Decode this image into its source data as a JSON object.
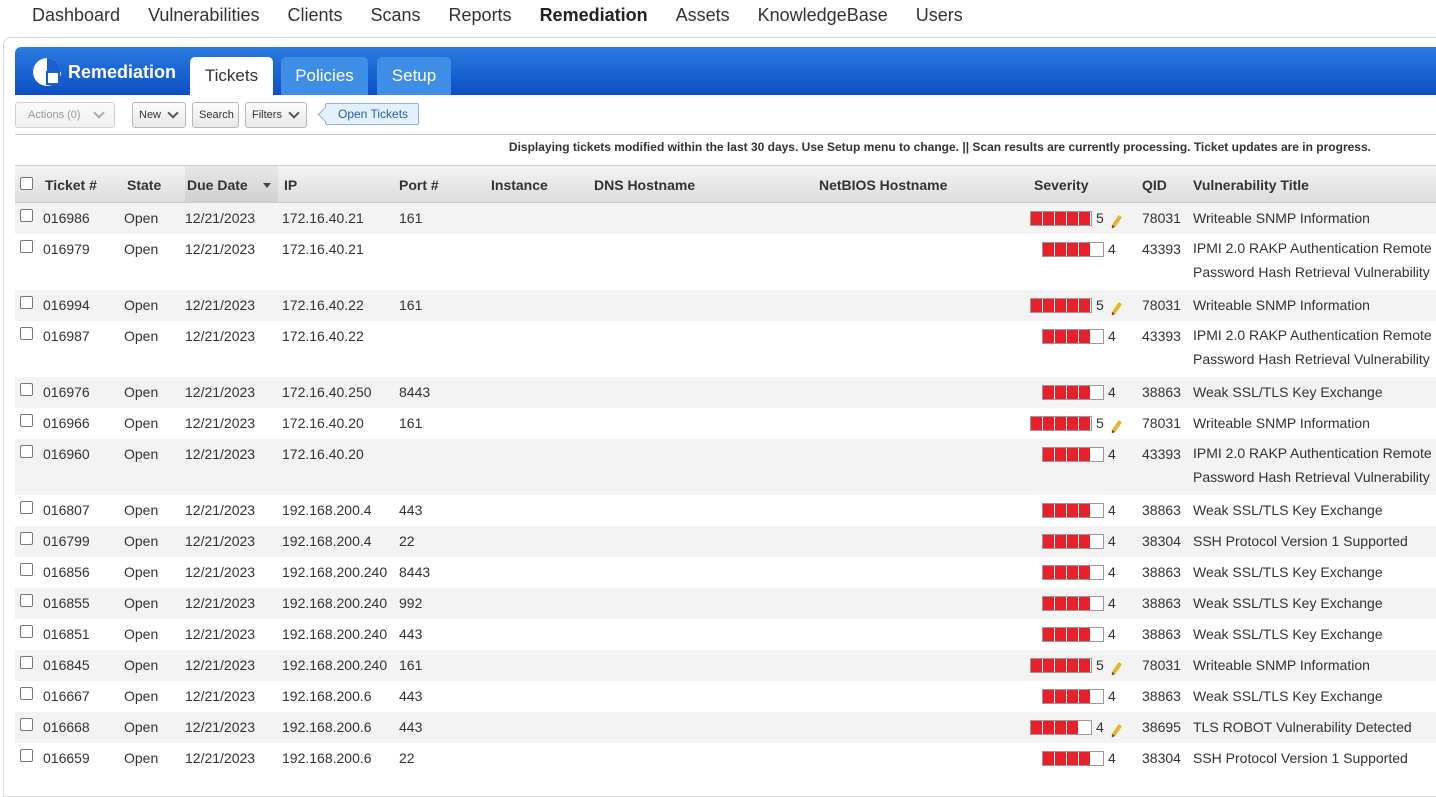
{
  "nav": [
    "Dashboard",
    "Vulnerabilities",
    "Clients",
    "Scans",
    "Reports",
    "Remediation",
    "Assets",
    "KnowledgeBase",
    "Users"
  ],
  "nav_active": "Remediation",
  "module": {
    "title": "Remediation",
    "tabs": [
      "Tickets",
      "Policies",
      "Setup"
    ]
  },
  "toolbar": {
    "actions": "Actions (0)",
    "new": "New",
    "search": "Search",
    "filters": "Filters",
    "open_tickets": "Open Tickets"
  },
  "banner": "Displaying tickets modified within the last 30 days. Use Setup menu to change. || Scan results are currently processing. Ticket updates are in progress.",
  "columns": [
    "Ticket #",
    "State",
    "Due Date",
    "IP",
    "Port #",
    "Instance",
    "DNS Hostname",
    "NetBIOS Hostname",
    "Severity",
    "QID",
    "Vulnerability Title"
  ],
  "colors": {
    "accent": "#1a5fd0",
    "severity": "#e8202a",
    "pencil": "#e8b52a"
  },
  "rows": [
    {
      "ticket": "016986",
      "state": "Open",
      "due": "12/21/2023",
      "ip": "172.16.40.21",
      "port": "161",
      "sev": "5",
      "qid": "78031",
      "title": "Writeable SNMP Information",
      "edit": true
    },
    {
      "ticket": "016979",
      "state": "Open",
      "due": "12/21/2023",
      "ip": "172.16.40.21",
      "port": "",
      "sev": "4",
      "qid": "43393",
      "title": "IPMI 2.0 RAKP Authentication Remote Password Hash Retrieval Vulnerability",
      "edit": false
    },
    {
      "ticket": "016994",
      "state": "Open",
      "due": "12/21/2023",
      "ip": "172.16.40.22",
      "port": "161",
      "sev": "5",
      "qid": "78031",
      "title": "Writeable SNMP Information",
      "edit": true
    },
    {
      "ticket": "016987",
      "state": "Open",
      "due": "12/21/2023",
      "ip": "172.16.40.22",
      "port": "",
      "sev": "4",
      "qid": "43393",
      "title": "IPMI 2.0 RAKP Authentication Remote Password Hash Retrieval Vulnerability",
      "edit": false
    },
    {
      "ticket": "016976",
      "state": "Open",
      "due": "12/21/2023",
      "ip": "172.16.40.250",
      "port": "8443",
      "sev": "4",
      "qid": "38863",
      "title": "Weak SSL/TLS Key Exchange",
      "edit": false
    },
    {
      "ticket": "016966",
      "state": "Open",
      "due": "12/21/2023",
      "ip": "172.16.40.20",
      "port": "161",
      "sev": "5",
      "qid": "78031",
      "title": "Writeable SNMP Information",
      "edit": true
    },
    {
      "ticket": "016960",
      "state": "Open",
      "due": "12/21/2023",
      "ip": "172.16.40.20",
      "port": "",
      "sev": "4",
      "qid": "43393",
      "title": "IPMI 2.0 RAKP Authentication Remote Password Hash Retrieval Vulnerability",
      "edit": false
    },
    {
      "ticket": "016807",
      "state": "Open",
      "due": "12/21/2023",
      "ip": "192.168.200.4",
      "port": "443",
      "sev": "4",
      "qid": "38863",
      "title": "Weak SSL/TLS Key Exchange",
      "edit": false
    },
    {
      "ticket": "016799",
      "state": "Open",
      "due": "12/21/2023",
      "ip": "192.168.200.4",
      "port": "22",
      "sev": "4",
      "qid": "38304",
      "title": "SSH Protocol Version 1 Supported",
      "edit": false
    },
    {
      "ticket": "016856",
      "state": "Open",
      "due": "12/21/2023",
      "ip": "192.168.200.240",
      "port": "8443",
      "sev": "4",
      "qid": "38863",
      "title": "Weak SSL/TLS Key Exchange",
      "edit": false
    },
    {
      "ticket": "016855",
      "state": "Open",
      "due": "12/21/2023",
      "ip": "192.168.200.240",
      "port": "992",
      "sev": "4",
      "qid": "38863",
      "title": "Weak SSL/TLS Key Exchange",
      "edit": false
    },
    {
      "ticket": "016851",
      "state": "Open",
      "due": "12/21/2023",
      "ip": "192.168.200.240",
      "port": "443",
      "sev": "4",
      "qid": "38863",
      "title": "Weak SSL/TLS Key Exchange",
      "edit": false
    },
    {
      "ticket": "016845",
      "state": "Open",
      "due": "12/21/2023",
      "ip": "192.168.200.240",
      "port": "161",
      "sev": "5",
      "qid": "78031",
      "title": "Writeable SNMP Information",
      "edit": true
    },
    {
      "ticket": "016667",
      "state": "Open",
      "due": "12/21/2023",
      "ip": "192.168.200.6",
      "port": "443",
      "sev": "4",
      "qid": "38863",
      "title": "Weak SSL/TLS Key Exchange",
      "edit": false
    },
    {
      "ticket": "016668",
      "state": "Open",
      "due": "12/21/2023",
      "ip": "192.168.200.6",
      "port": "443",
      "sev": "4",
      "qid": "38695",
      "title": "TLS ROBOT Vulnerability Detected",
      "edit": true
    },
    {
      "ticket": "016659",
      "state": "Open",
      "due": "12/21/2023",
      "ip": "192.168.200.6",
      "port": "22",
      "sev": "4",
      "qid": "38304",
      "title": "SSH Protocol Version 1 Supported",
      "edit": false
    }
  ]
}
